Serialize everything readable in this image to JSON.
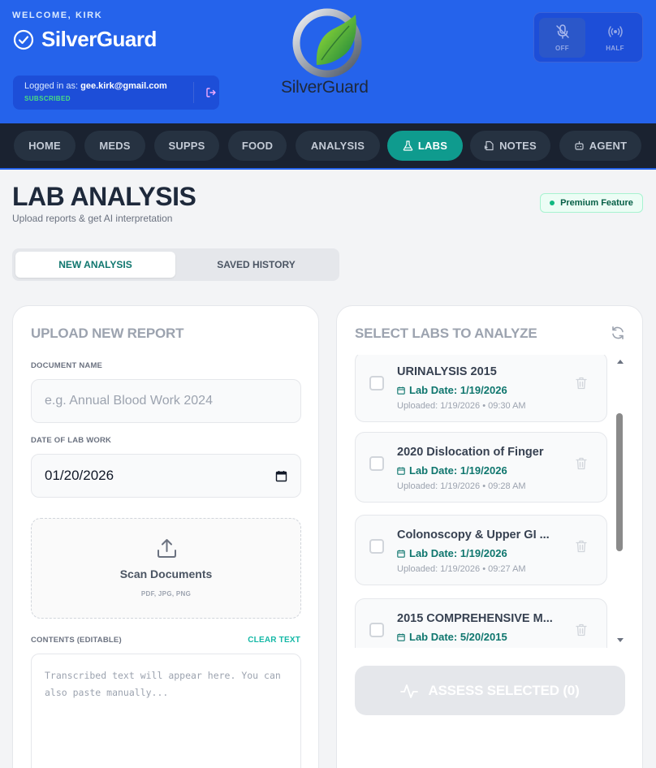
{
  "header": {
    "welcome": "WELCOME, KIRK",
    "brand_title": "SilverGuard",
    "logo_text": "SilverGuard",
    "login_prefix": "Logged in as: ",
    "login_email": "gee.kirk@gmail.com",
    "subscription": "SUBSCRIBED",
    "modes": [
      {
        "label": "OFF",
        "icon": "mic-off-icon"
      },
      {
        "label": "HALF",
        "icon": "broadcast-icon"
      }
    ]
  },
  "nav": {
    "items": [
      {
        "label": "HOME"
      },
      {
        "label": "MEDS"
      },
      {
        "label": "SUPPS"
      },
      {
        "label": "FOOD"
      },
      {
        "label": "ANALYSIS"
      },
      {
        "label": "LABS",
        "icon": "flask-icon",
        "active": true
      },
      {
        "label": "NOTES",
        "icon": "notes-icon"
      },
      {
        "label": "AGENT",
        "icon": "bot-icon"
      }
    ]
  },
  "page": {
    "title": "LAB ANALYSIS",
    "subtitle": "Upload reports & get AI interpretation",
    "premium": "Premium Feature"
  },
  "tabs": {
    "new": "NEW ANALYSIS",
    "saved": "SAVED HISTORY"
  },
  "upload": {
    "title": "UPLOAD NEW REPORT",
    "doc_name_label": "DOCUMENT NAME",
    "doc_name_placeholder": "e.g. Annual Blood Work 2024",
    "date_label": "DATE OF LAB WORK",
    "date_value": "01/20/2026",
    "scan_title": "Scan Documents",
    "scan_formats": "PDF, JPG, PNG",
    "contents_label": "CONTENTS (EDITABLE)",
    "clear_label": "CLEAR TEXT",
    "contents_placeholder": "Transcribed text will appear here. You can also paste manually..."
  },
  "labs": {
    "title": "SELECT LABS TO ANALYZE",
    "items": [
      {
        "title": "URINALYSIS 2015",
        "date": "Lab Date: 1/19/2026",
        "uploaded": "Uploaded: 1/19/2026 • 09:30 AM"
      },
      {
        "title": "2020 Dislocation of Finger",
        "date": "Lab Date: 1/19/2026",
        "uploaded": "Uploaded: 1/19/2026 • 09:28 AM"
      },
      {
        "title": "Colonoscopy & Upper GI ...",
        "date": "Lab Date: 1/19/2026",
        "uploaded": "Uploaded: 1/19/2026 • 09:27 AM"
      },
      {
        "title": "2015 COMPREHENSIVE M...",
        "date": "Lab Date: 5/20/2015",
        "uploaded": ""
      }
    ],
    "assess_label": "ASSESS SELECTED (0)"
  },
  "colors": {
    "header_blue": "#2563eb",
    "nav_dark": "#1a2230",
    "accent_teal": "#0f9b8e"
  }
}
